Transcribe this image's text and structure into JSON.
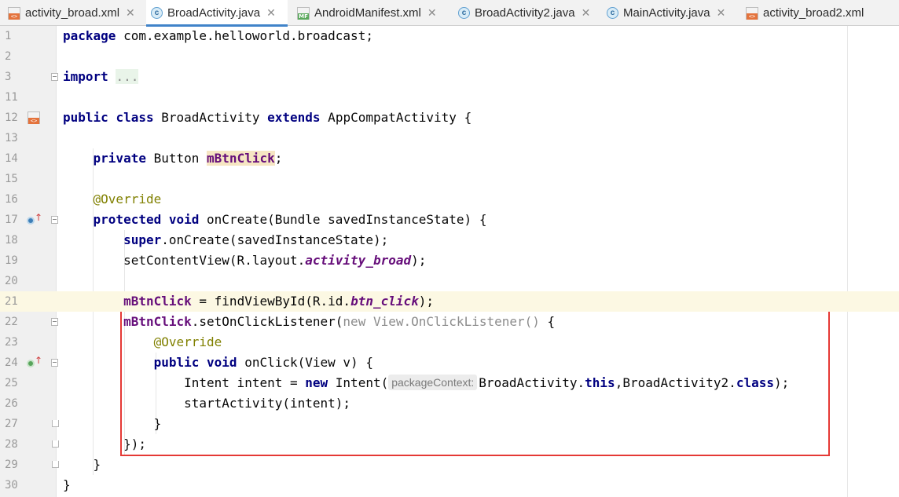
{
  "tabs": [
    {
      "label": "activity_broad.xml",
      "icon": "xml-layout-icon"
    },
    {
      "label": "BroadActivity.java",
      "icon": "java-class-icon",
      "active": true
    },
    {
      "label": "AndroidManifest.xml",
      "icon": "manifest-icon"
    },
    {
      "label": "BroadActivity2.java",
      "icon": "java-class-icon"
    },
    {
      "label": "MainActivity.java",
      "icon": "java-class-icon"
    },
    {
      "label": "activity_broad2.xml",
      "icon": "xml-layout-icon"
    }
  ],
  "close_glyph": "✕",
  "lines": [
    {
      "n": "1",
      "parts": [
        {
          "t": "package",
          "c": "kw"
        },
        {
          "t": " com.example.helloworld.broadcast;"
        }
      ]
    },
    {
      "n": "2",
      "parts": []
    },
    {
      "n": "3",
      "parts": [
        {
          "t": "import",
          "c": "kw"
        },
        {
          "t": " "
        },
        {
          "t": "...",
          "c": "fold-import"
        }
      ],
      "fold": "minus"
    },
    {
      "n": "11",
      "parts": []
    },
    {
      "n": "12",
      "parts": [
        {
          "t": "public",
          "c": "kw"
        },
        {
          "t": " "
        },
        {
          "t": "class",
          "c": "kw"
        },
        {
          "t": " BroadActivity "
        },
        {
          "t": "extends",
          "c": "kw"
        },
        {
          "t": " AppCompatActivity {"
        }
      ],
      "gutter_icon": "layout-icon"
    },
    {
      "n": "13",
      "parts": []
    },
    {
      "n": "14",
      "parts": [
        {
          "t": "    "
        },
        {
          "t": "private",
          "c": "kw"
        },
        {
          "t": " Button "
        },
        {
          "t": "mBtnClick",
          "c": "fld hl"
        },
        {
          "t": ";"
        }
      ]
    },
    {
      "n": "15",
      "parts": []
    },
    {
      "n": "16",
      "parts": [
        {
          "t": "    "
        },
        {
          "t": "@Override",
          "c": "ann"
        }
      ]
    },
    {
      "n": "17",
      "parts": [
        {
          "t": "    "
        },
        {
          "t": "protected",
          "c": "kw"
        },
        {
          "t": " "
        },
        {
          "t": "void",
          "c": "kw"
        },
        {
          "t": " onCreate(Bundle savedInstanceState) {"
        }
      ],
      "gutter_icon": "override-icon-o",
      "fold": "minus"
    },
    {
      "n": "18",
      "parts": [
        {
          "t": "        "
        },
        {
          "t": "super",
          "c": "kw"
        },
        {
          "t": ".onCreate(savedInstanceState);"
        }
      ]
    },
    {
      "n": "19",
      "parts": [
        {
          "t": "        setContentView(R.layout."
        },
        {
          "t": "activity_broad",
          "c": "ital"
        },
        {
          "t": ");"
        }
      ]
    },
    {
      "n": "20",
      "parts": []
    },
    {
      "n": "21",
      "parts": [
        {
          "t": "        "
        },
        {
          "t": "mBtnClick",
          "c": "fld"
        },
        {
          "t": " = findViewById(R.id."
        },
        {
          "t": "btn_click",
          "c": "ital"
        },
        {
          "t": ");"
        }
      ],
      "caret": true
    },
    {
      "n": "22",
      "parts": [
        {
          "t": "        "
        },
        {
          "t": "mBtnClick",
          "c": "fld"
        },
        {
          "t": ".setOnClickListener("
        },
        {
          "t": "new",
          "c": "gray"
        },
        {
          "t": " "
        },
        {
          "t": "View.OnClickListener()",
          "c": "gray"
        },
        {
          "t": " {"
        }
      ],
      "fold": "minus"
    },
    {
      "n": "23",
      "parts": [
        {
          "t": "            "
        },
        {
          "t": "@Override",
          "c": "ann"
        }
      ]
    },
    {
      "n": "24",
      "parts": [
        {
          "t": "            "
        },
        {
          "t": "public",
          "c": "kw"
        },
        {
          "t": " "
        },
        {
          "t": "void",
          "c": "kw"
        },
        {
          "t": " onClick(View v) {"
        }
      ],
      "gutter_icon": "override-icon-i",
      "fold": "minus"
    },
    {
      "n": "25",
      "parts": [
        {
          "t": "                Intent intent = "
        },
        {
          "t": "new",
          "c": "kw"
        },
        {
          "t": " Intent("
        },
        {
          "t": "packageContext:",
          "c": "hint"
        },
        {
          "t": "BroadActivity."
        },
        {
          "t": "this",
          "c": "kw"
        },
        {
          "t": ",BroadActivity2."
        },
        {
          "t": "class",
          "c": "kw"
        },
        {
          "t": ");"
        }
      ]
    },
    {
      "n": "26",
      "parts": [
        {
          "t": "                startActivity(intent);"
        }
      ]
    },
    {
      "n": "27",
      "parts": [
        {
          "t": "            }"
        }
      ],
      "fold": "end"
    },
    {
      "n": "28",
      "parts": [
        {
          "t": "        });"
        }
      ],
      "fold": "end"
    },
    {
      "n": "29",
      "parts": [
        {
          "t": "    }"
        }
      ],
      "fold": "end"
    },
    {
      "n": "30",
      "parts": [
        {
          "t": "}"
        }
      ]
    }
  ],
  "colors": {
    "keyword": "#000080",
    "annotation": "#808000",
    "field": "#660e7a",
    "caret_line": "#fcf8e3",
    "highlight_box": "#e53935"
  }
}
